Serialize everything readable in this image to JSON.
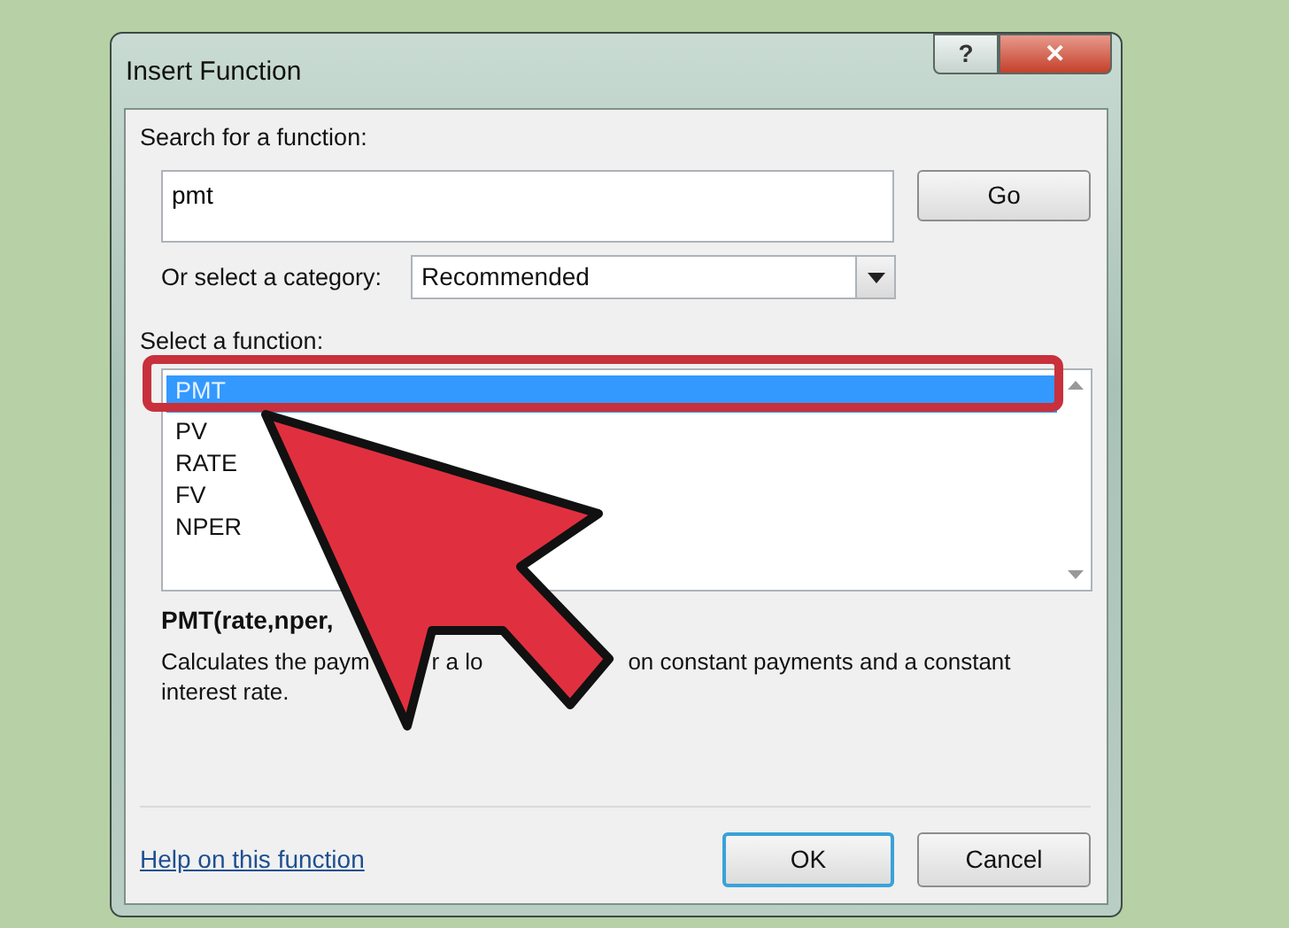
{
  "window": {
    "title": "Insert Function",
    "help_button": "?",
    "close_button": "✕"
  },
  "search": {
    "label": "Search for a function:",
    "value": "pmt",
    "button": "Go"
  },
  "category": {
    "label": "Or select a category:",
    "value": "Recommended"
  },
  "functions": {
    "label": "Select a function:",
    "items": [
      {
        "name": "PMT",
        "selected": true
      },
      {
        "name": "PV",
        "selected": false
      },
      {
        "name": "RATE",
        "selected": false
      },
      {
        "name": "FV",
        "selected": false
      },
      {
        "name": "NPER",
        "selected": false
      }
    ]
  },
  "syntax": "PMT(rate,nper,",
  "description": [
    {
      "fragments": [
        "Calculates the paym",
        "r a lo",
        "on constant payments and a constant"
      ]
    },
    {
      "fragments": [
        "interest rate."
      ]
    }
  ],
  "help_link": "Help on this function",
  "buttons": [
    {
      "label": "OK",
      "kind": "default"
    },
    {
      "label": "Cancel",
      "kind": "normal"
    }
  ]
}
